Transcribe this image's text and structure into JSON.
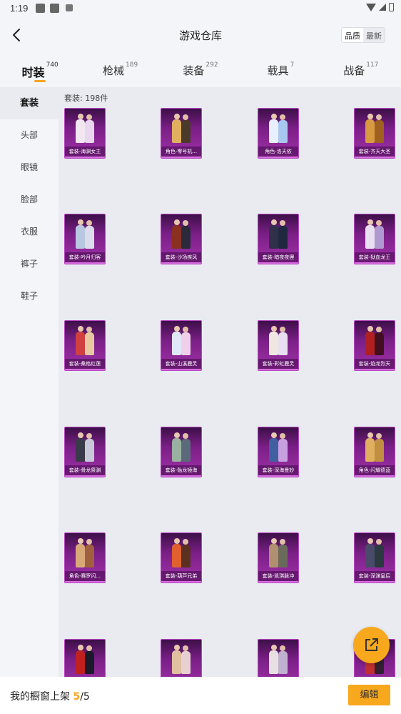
{
  "status_bar": {
    "time": "1:19"
  },
  "header": {
    "title": "游戏仓库",
    "sort_options": [
      {
        "label": "品质",
        "active": true
      },
      {
        "label": "最新",
        "active": false
      }
    ]
  },
  "tabs": [
    {
      "label": "时装",
      "count": "740",
      "active": true
    },
    {
      "label": "枪械",
      "count": "189",
      "active": false
    },
    {
      "label": "装备",
      "count": "292",
      "active": false
    },
    {
      "label": "载具",
      "count": "7",
      "active": false
    },
    {
      "label": "战备",
      "count": "117",
      "active": false
    }
  ],
  "sidebar": {
    "items": [
      {
        "label": "套装",
        "active": true
      },
      {
        "label": "头部",
        "active": false
      },
      {
        "label": "眼镜",
        "active": false
      },
      {
        "label": "脸部",
        "active": false
      },
      {
        "label": "衣服",
        "active": false
      },
      {
        "label": "裤子",
        "active": false
      },
      {
        "label": "鞋子",
        "active": false
      }
    ]
  },
  "content": {
    "count_label": "套装: 198件",
    "items": [
      {
        "label": "套装-海渊女主",
        "colors": [
          "#f2e6f0",
          "#e9d6ef"
        ]
      },
      {
        "label": "角色-零号机...",
        "colors": [
          "#e0b060",
          "#4a3a2a"
        ]
      },
      {
        "label": "角色-洛天依",
        "colors": [
          "#e8f0ff",
          "#a8c8f0"
        ]
      },
      {
        "label": "套装-齐天大圣",
        "colors": [
          "#d89a40",
          "#a06020"
        ]
      },
      {
        "label": "套装-吟月归客",
        "colors": [
          "#b8c8e0",
          "#dcdcec"
        ]
      },
      {
        "label": "套装-沙场疾风",
        "colors": [
          "#8a3020",
          "#2a2a3a"
        ]
      },
      {
        "label": "套装-暗夜夜狸",
        "colors": [
          "#30304a",
          "#202840"
        ]
      },
      {
        "label": "套装-狱血龙王",
        "colors": [
          "#e8e0f0",
          "#b098d0"
        ]
      },
      {
        "label": "套装-桑格红莲",
        "colors": [
          "#d04040",
          "#e8c8a0"
        ]
      },
      {
        "label": "套装-山溪鹿灵",
        "colors": [
          "#e0e8f8",
          "#f0d0e8"
        ]
      },
      {
        "label": "套装-彩虹鹿灵",
        "colors": [
          "#f0e8e0",
          "#e8e0f0"
        ]
      },
      {
        "label": "套装-焰龙烈天",
        "colors": [
          "#b02020",
          "#401020"
        ]
      },
      {
        "label": "套装-骨龙祭渊",
        "colors": [
          "#3a3a4a",
          "#c8c8d8"
        ]
      },
      {
        "label": "套装-骷龙镜海",
        "colors": [
          "#9ab0a0",
          "#5a6a7a"
        ]
      },
      {
        "label": "套装-深海曼妙",
        "colors": [
          "#4060a0",
          "#c8a0e0"
        ]
      },
      {
        "label": "角色-闪耀德蓝",
        "colors": [
          "#e0b060",
          "#c09040"
        ]
      },
      {
        "label": "角色-赛罗闪...",
        "colors": [
          "#d8a878",
          "#a06040"
        ]
      },
      {
        "label": "套装-葫芦兄弟",
        "colors": [
          "#e06030",
          "#5a3020"
        ]
      },
      {
        "label": "套装-凯琪脉冲",
        "colors": [
          "#b09070",
          "#6a6a5a"
        ]
      },
      {
        "label": "套装-深渊皇后",
        "colors": [
          "#4a4a6a",
          "#2a3a40"
        ]
      },
      {
        "label": "",
        "colors": [
          "#c02020",
          "#1a1a2a"
        ]
      },
      {
        "label": "",
        "colors": [
          "#e0c0a0",
          "#e8d0d0"
        ]
      },
      {
        "label": "",
        "colors": [
          "#e8e0e0",
          "#c0b0d0"
        ]
      },
      {
        "label": "",
        "colors": [
          "#c03030",
          "#302030"
        ]
      }
    ]
  },
  "bottom_bar": {
    "text_prefix": "我的橱窗上架",
    "shelved": "5",
    "separator": "/",
    "capacity": "5",
    "edit_label": "编辑"
  },
  "colors": {
    "accent": "#f7a81d",
    "card_purple": "#7a1f86"
  }
}
